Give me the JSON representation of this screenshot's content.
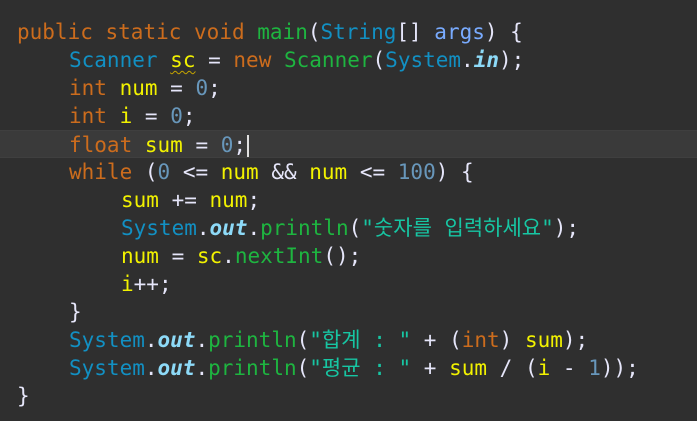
{
  "editor": {
    "lines": [
      {
        "indent": 0,
        "tokens": [
          {
            "t": "public",
            "c": "kw"
          },
          {
            "t": " ",
            "c": "plain"
          },
          {
            "t": "static",
            "c": "kw"
          },
          {
            "t": " ",
            "c": "plain"
          },
          {
            "t": "void",
            "c": "kw"
          },
          {
            "t": " ",
            "c": "plain"
          },
          {
            "t": "main",
            "c": "method"
          },
          {
            "t": "(",
            "c": "op"
          },
          {
            "t": "String",
            "c": "type"
          },
          {
            "t": "[] ",
            "c": "op"
          },
          {
            "t": "args",
            "c": "param"
          },
          {
            "t": ") {",
            "c": "op"
          }
        ]
      },
      {
        "indent": 1,
        "tokens": [
          {
            "t": "Scanner",
            "c": "type"
          },
          {
            "t": " ",
            "c": "plain"
          },
          {
            "t": "sc",
            "c": "var warn"
          },
          {
            "t": " = ",
            "c": "op"
          },
          {
            "t": "new",
            "c": "kw"
          },
          {
            "t": " ",
            "c": "plain"
          },
          {
            "t": "Scanner",
            "c": "method"
          },
          {
            "t": "(",
            "c": "op"
          },
          {
            "t": "System",
            "c": "type"
          },
          {
            "t": ".",
            "c": "op"
          },
          {
            "t": "in",
            "c": "field-in"
          },
          {
            "t": ");",
            "c": "op"
          }
        ]
      },
      {
        "indent": 1,
        "tokens": [
          {
            "t": "int",
            "c": "kw"
          },
          {
            "t": " ",
            "c": "plain"
          },
          {
            "t": "num",
            "c": "var"
          },
          {
            "t": " = ",
            "c": "op"
          },
          {
            "t": "0",
            "c": "num"
          },
          {
            "t": ";",
            "c": "op"
          }
        ]
      },
      {
        "indent": 1,
        "tokens": [
          {
            "t": "int",
            "c": "kw"
          },
          {
            "t": " ",
            "c": "plain"
          },
          {
            "t": "i",
            "c": "var"
          },
          {
            "t": " = ",
            "c": "op"
          },
          {
            "t": "0",
            "c": "num"
          },
          {
            "t": ";",
            "c": "op"
          }
        ]
      },
      {
        "indent": 1,
        "current": true,
        "caret": true,
        "tokens": [
          {
            "t": "float",
            "c": "kw"
          },
          {
            "t": " ",
            "c": "plain"
          },
          {
            "t": "sum",
            "c": "var"
          },
          {
            "t": " = ",
            "c": "op"
          },
          {
            "t": "0",
            "c": "num"
          },
          {
            "t": ";",
            "c": "op"
          }
        ]
      },
      {
        "indent": 1,
        "tokens": [
          {
            "t": "while",
            "c": "kw"
          },
          {
            "t": " (",
            "c": "op"
          },
          {
            "t": "0",
            "c": "num"
          },
          {
            "t": " <= ",
            "c": "op"
          },
          {
            "t": "num",
            "c": "var"
          },
          {
            "t": " && ",
            "c": "op"
          },
          {
            "t": "num",
            "c": "var"
          },
          {
            "t": " <= ",
            "c": "op"
          },
          {
            "t": "100",
            "c": "num"
          },
          {
            "t": ") {",
            "c": "op"
          }
        ]
      },
      {
        "indent": 2,
        "tokens": [
          {
            "t": "sum",
            "c": "var"
          },
          {
            "t": " += ",
            "c": "op"
          },
          {
            "t": "num",
            "c": "var"
          },
          {
            "t": ";",
            "c": "op"
          }
        ]
      },
      {
        "indent": 2,
        "tokens": [
          {
            "t": "System",
            "c": "type"
          },
          {
            "t": ".",
            "c": "op"
          },
          {
            "t": "out",
            "c": "field"
          },
          {
            "t": ".",
            "c": "op"
          },
          {
            "t": "println",
            "c": "method"
          },
          {
            "t": "(",
            "c": "op"
          },
          {
            "t": "\"숫자를 입력하세요\"",
            "c": "str"
          },
          {
            "t": ");",
            "c": "op"
          }
        ]
      },
      {
        "indent": 2,
        "tokens": [
          {
            "t": "num",
            "c": "var"
          },
          {
            "t": " = ",
            "c": "op"
          },
          {
            "t": "sc",
            "c": "var"
          },
          {
            "t": ".",
            "c": "op"
          },
          {
            "t": "nextInt",
            "c": "method"
          },
          {
            "t": "();",
            "c": "op"
          }
        ]
      },
      {
        "indent": 2,
        "tokens": [
          {
            "t": "i",
            "c": "var"
          },
          {
            "t": "++;",
            "c": "op"
          }
        ]
      },
      {
        "indent": 1,
        "tokens": [
          {
            "t": "}",
            "c": "op"
          }
        ]
      },
      {
        "indent": 1,
        "tokens": [
          {
            "t": "System",
            "c": "type"
          },
          {
            "t": ".",
            "c": "op"
          },
          {
            "t": "out",
            "c": "field"
          },
          {
            "t": ".",
            "c": "op"
          },
          {
            "t": "println",
            "c": "method"
          },
          {
            "t": "(",
            "c": "op"
          },
          {
            "t": "\"합계 : \"",
            "c": "str"
          },
          {
            "t": " + (",
            "c": "op"
          },
          {
            "t": "int",
            "c": "kw"
          },
          {
            "t": ") ",
            "c": "op"
          },
          {
            "t": "sum",
            "c": "var"
          },
          {
            "t": ");",
            "c": "op"
          }
        ]
      },
      {
        "indent": 1,
        "tokens": [
          {
            "t": "System",
            "c": "type"
          },
          {
            "t": ".",
            "c": "op"
          },
          {
            "t": "out",
            "c": "field"
          },
          {
            "t": ".",
            "c": "op"
          },
          {
            "t": "println",
            "c": "method"
          },
          {
            "t": "(",
            "c": "op"
          },
          {
            "t": "\"평균 : \"",
            "c": "str"
          },
          {
            "t": " + ",
            "c": "op"
          },
          {
            "t": "sum",
            "c": "var"
          },
          {
            "t": " / (",
            "c": "op"
          },
          {
            "t": "i",
            "c": "var"
          },
          {
            "t": " - ",
            "c": "op"
          },
          {
            "t": "1",
            "c": "num"
          },
          {
            "t": "));",
            "c": "op"
          }
        ]
      },
      {
        "indent": 0,
        "tokens": [
          {
            "t": "}",
            "c": "op"
          }
        ]
      }
    ]
  },
  "colors": {
    "background": "#2f2f2f",
    "current_line": "#3a3a3a",
    "keyword": "#cc6c1d",
    "type": "#1290c3",
    "method": "#1eb540",
    "string": "#17c6a3",
    "number": "#6897bb",
    "variable": "#f2f200",
    "field": "#8ddaf8"
  }
}
